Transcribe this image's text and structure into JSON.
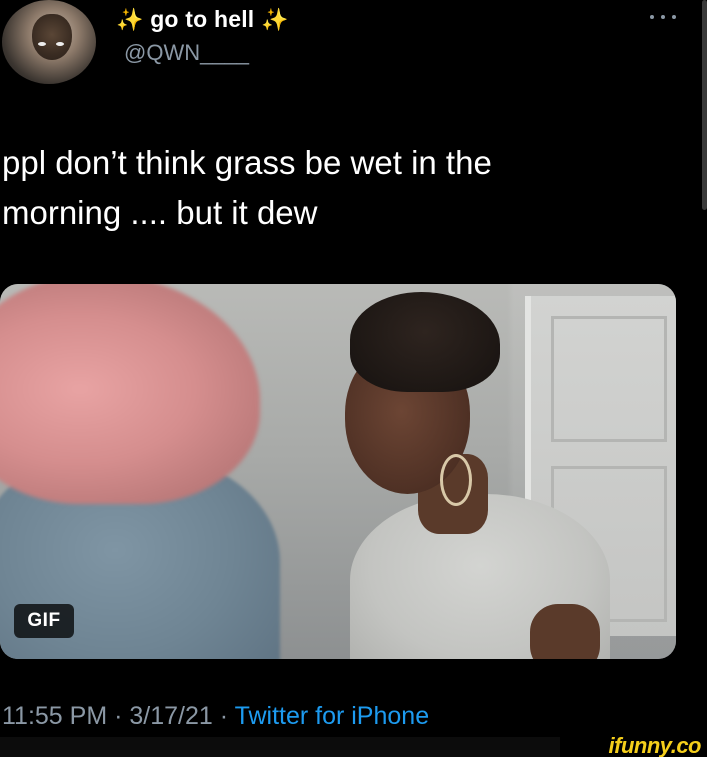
{
  "tweet": {
    "sparkle_left": "✨",
    "display_name": "go to hell",
    "sparkle_right": "✨",
    "handle": "@QWN____",
    "text_line1": "ppl don’t think grass be wet in the",
    "text_line2": "morning .... but it dew",
    "media_badge": "GIF",
    "time": "11:55 PM",
    "separator1": " · ",
    "date": "3/17/21",
    "separator2": " · ",
    "source": "Twitter for iPhone"
  },
  "icons": {
    "more": "more-horizontal-icon"
  },
  "watermark": {
    "text": "ifunny.co"
  },
  "colors": {
    "background": "#000000",
    "text": "#ffffff",
    "secondary": "#8b98a5",
    "link": "#1d9bf0",
    "sparkle": "#f3c94a",
    "watermark": "#f5cf1b"
  }
}
